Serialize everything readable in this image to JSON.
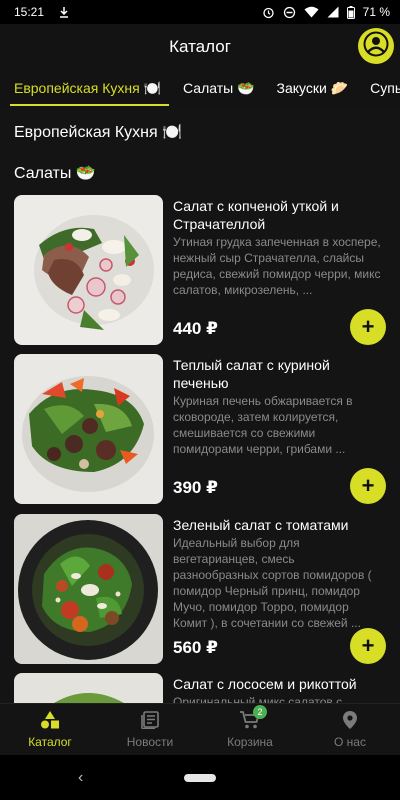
{
  "status_bar": {
    "time": "15:21",
    "battery": "71 %",
    "icons": [
      "download-icon",
      "alarm-icon",
      "dnd-icon",
      "wifi-icon",
      "signal-icon",
      "battery-icon"
    ]
  },
  "header": {
    "title": "Каталог"
  },
  "tabs": [
    {
      "label": "Европейская Кухня 🍽️",
      "active": true
    },
    {
      "label": "Салаты 🥗",
      "active": false
    },
    {
      "label": "Закуски 🥟",
      "active": false
    },
    {
      "label": "Супы 🍲",
      "active": false
    }
  ],
  "content": {
    "category_title": "Европейская Кухня 🍽️",
    "section_title": "Салаты 🥗",
    "items": [
      {
        "name": "Салат с копченой уткой и Страчателлой",
        "description": "Утиная грудка запеченная в хоспере, нежный сыр Страчателла, слайсы редиса, свежий помидор черри, микс салатов, микрозелень, ...",
        "price": "440 ₽"
      },
      {
        "name": "Теплый салат с куриной печенью",
        "description": "Куриная печень обжаривается в сковороде, затем колируется, смешивается со свежими помидорами черри, грибами ...",
        "price": "390 ₽"
      },
      {
        "name": "Зеленый салат с томатами",
        "description": "Идеальный выбор для вегетарианцев, смесь разнообразных сортов помидоров ( помидор Черный принц, помидор Мучо, помидор Торро, помидор Комит ),  в сочетании со свежей ...",
        "price": "560 ₽"
      },
      {
        "name": "Салат с лососем и рикоттой",
        "description": "Оригинальный микс салатов с",
        "price": ""
      }
    ],
    "add_label": "+"
  },
  "bottom_nav": [
    {
      "label": "Каталог",
      "icon": "catalog-icon",
      "active": true
    },
    {
      "label": "Новости",
      "icon": "news-icon",
      "active": false
    },
    {
      "label": "Корзина",
      "icon": "cart-icon",
      "active": false,
      "badge": "2"
    },
    {
      "label": "О нас",
      "icon": "location-icon",
      "active": false
    }
  ],
  "colors": {
    "accent": "#d8de25",
    "background": "#141414",
    "badge": "#4caf50"
  }
}
